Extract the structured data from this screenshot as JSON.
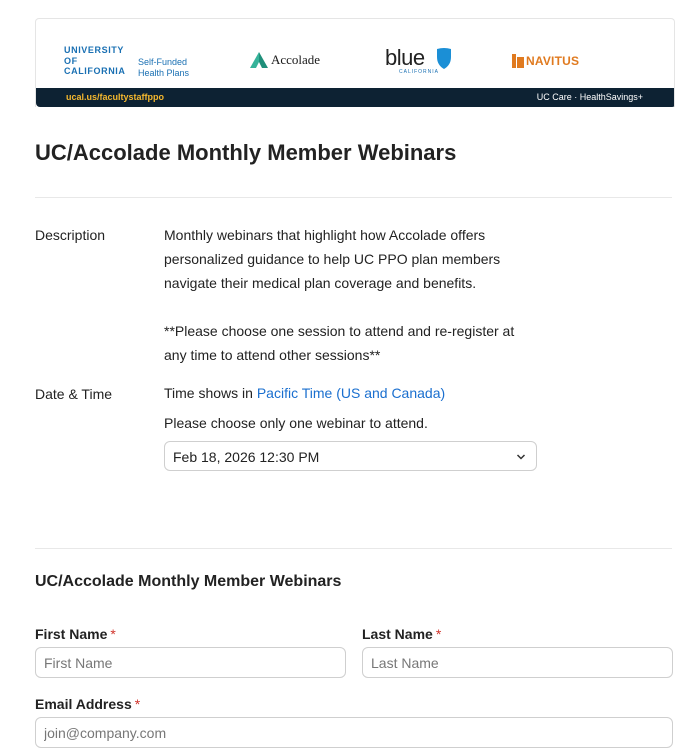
{
  "banner": {
    "uc_lines": [
      "UNIVERSITY",
      "OF",
      "CALIFORNIA"
    ],
    "uc_sub_lines": [
      "Self-Funded",
      "Health Plans"
    ],
    "accolade": "Accolade",
    "blue": "blue",
    "blue_sub": "CALIFORNIA",
    "navitus": "NAVITUS",
    "url": "ucal.us/facultystaffppo",
    "right_text": "UC Care · HealthSavings+"
  },
  "page_title": "UC/Accolade Monthly Member Webinars",
  "description": {
    "label": "Description",
    "paragraph1": "Monthly webinars that highlight how Accolade offers personalized guidance to help UC PPO plan members navigate their medical plan coverage and benefits.",
    "paragraph2": "**Please choose one session to attend and re-register at any time to attend other sessions**"
  },
  "datetime": {
    "label": "Date & Time",
    "tz_prefix": "Time shows in ",
    "tz_link": "Pacific Time (US and Canada)",
    "instruction": "Please choose only one webinar to attend.",
    "selected": "Feb 18, 2026 12:30 PM"
  },
  "form": {
    "section_title": "UC/Accolade Monthly Member Webinars",
    "first_name": {
      "label": "First Name",
      "placeholder": "First Name",
      "required": "*"
    },
    "last_name": {
      "label": "Last Name",
      "placeholder": "Last Name",
      "required": "*"
    },
    "email": {
      "label": "Email Address",
      "placeholder": "join@company.com",
      "required": "*"
    }
  },
  "colors": {
    "accent_link": "#1a6fcf",
    "banner_bar": "#0d2233",
    "banner_url": "#f5b82e",
    "required": "#d0342c"
  }
}
